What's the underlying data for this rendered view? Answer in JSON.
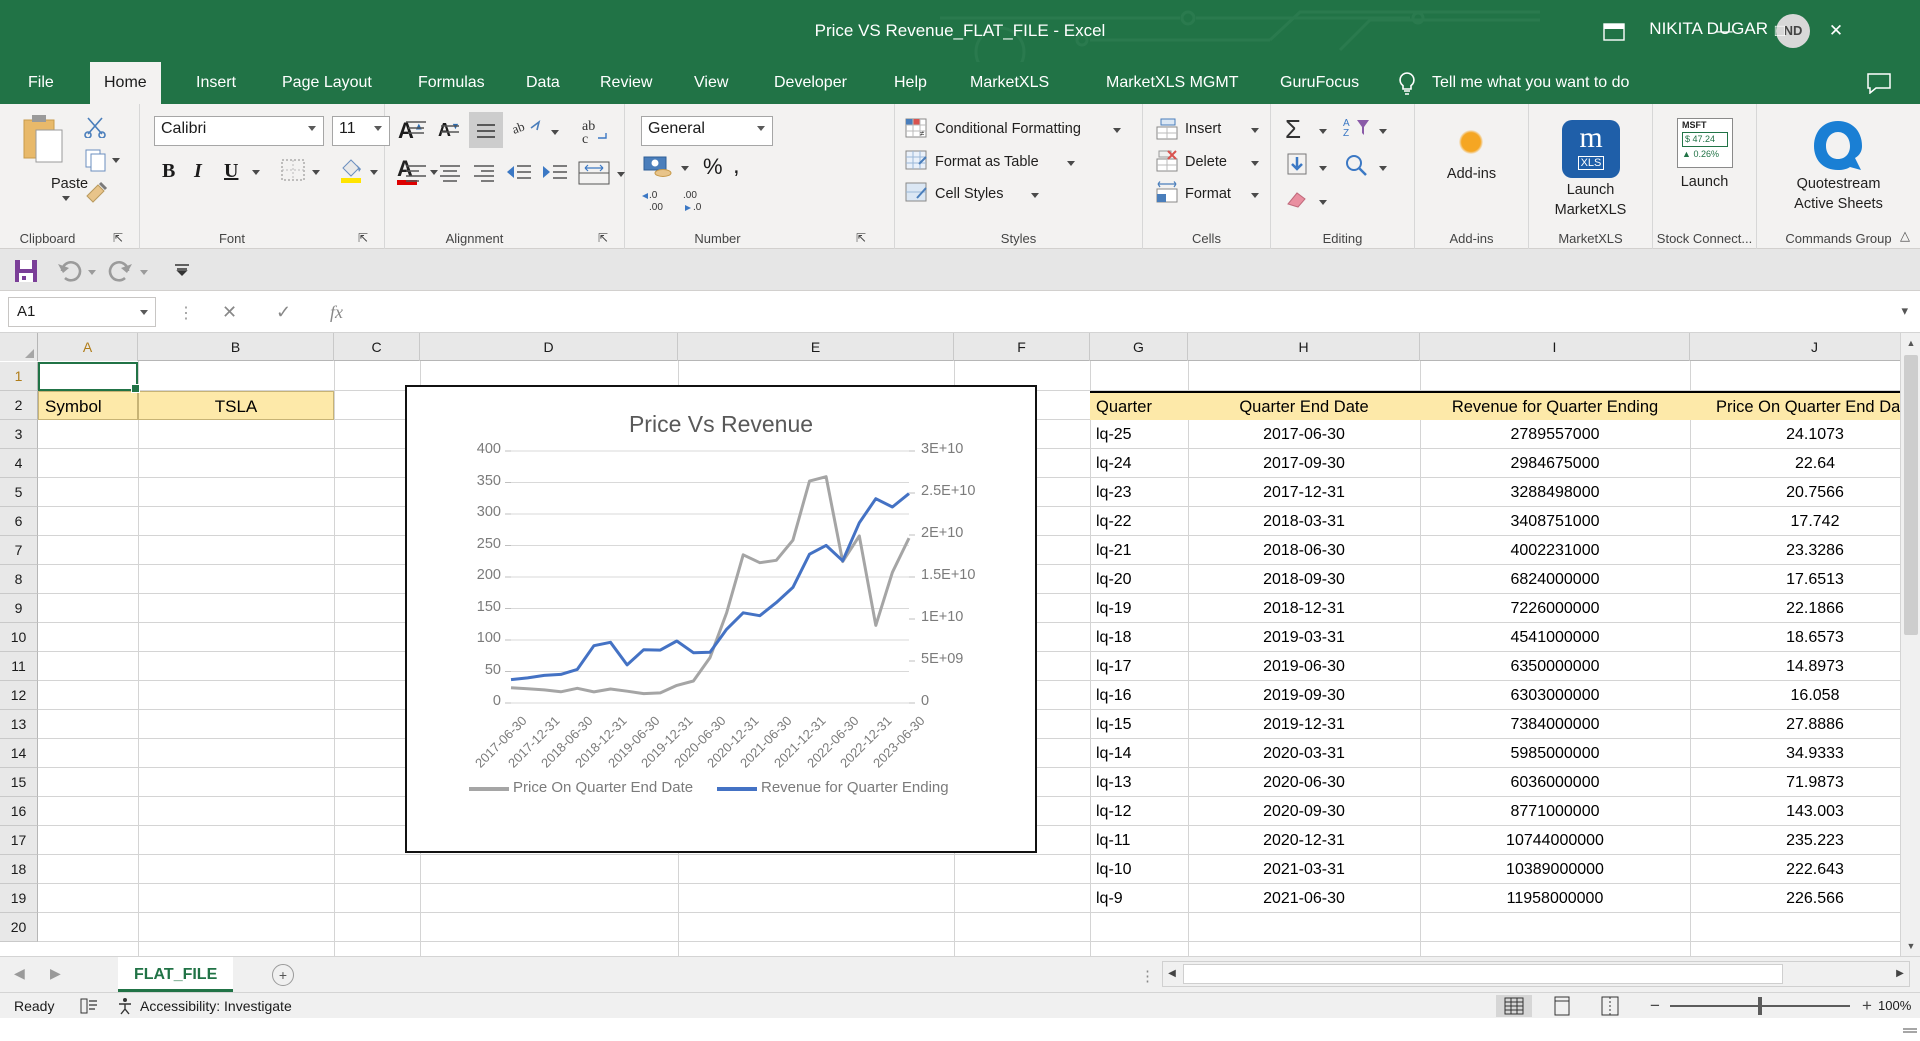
{
  "window": {
    "title": "Price VS Revenue_FLAT_FILE  -  Excel",
    "user": "NIKITA DUGAR",
    "avatar_initials": "ND",
    "ribbon_display_icon": "ribbon-display-options-icon",
    "minimize": "—",
    "maximize": "□",
    "close": "✕"
  },
  "tabs": [
    {
      "label": "File",
      "active": false
    },
    {
      "label": "Home",
      "active": true
    },
    {
      "label": "Insert",
      "active": false
    },
    {
      "label": "Page Layout",
      "active": false
    },
    {
      "label": "Formulas",
      "active": false
    },
    {
      "label": "Data",
      "active": false
    },
    {
      "label": "Review",
      "active": false
    },
    {
      "label": "View",
      "active": false
    },
    {
      "label": "Developer",
      "active": false
    },
    {
      "label": "Help",
      "active": false
    },
    {
      "label": "MarketXLS",
      "active": false
    },
    {
      "label": "MarketXLS MGMT",
      "active": false
    },
    {
      "label": "GuruFocus",
      "active": false
    }
  ],
  "tellme": "Tell me what you want to do",
  "ribbon": {
    "groups": [
      {
        "name": "Clipboard",
        "label": "Clipboard"
      },
      {
        "name": "Font",
        "label": "Font"
      },
      {
        "name": "Alignment",
        "label": "Alignment"
      },
      {
        "name": "Number",
        "label": "Number"
      },
      {
        "name": "Styles",
        "label": "Styles"
      },
      {
        "name": "Cells",
        "label": "Cells"
      },
      {
        "name": "Editing",
        "label": "Editing"
      },
      {
        "name": "Add-ins",
        "label": "Add-ins"
      },
      {
        "name": "MarketXLS",
        "label": "MarketXLS"
      },
      {
        "name": "StockConnect",
        "label": "Stock Connect..."
      },
      {
        "name": "CommandsGroup",
        "label": "Commands Group"
      }
    ],
    "clipboard": {
      "paste": "Paste",
      "cut_icon": "scissors-icon",
      "copy_icon": "copy-icon",
      "format_painter_icon": "format-painter-icon"
    },
    "font": {
      "family": "Calibri",
      "size": "11",
      "bold": "B",
      "italic": "I",
      "underline": "U",
      "grow_icon": "increase-font-size-icon",
      "shrink_icon": "decrease-font-size-icon",
      "borders_icon": "borders-icon",
      "fill_color_icon": "fill-color-icon",
      "font_color_icon": "font-color-icon"
    },
    "alignment": {
      "top_align_icon": "align-top-icon",
      "middle_align_icon": "align-middle-icon",
      "bottom_align_icon": "align-bottom-icon",
      "orientation_icon": "text-orientation-icon",
      "align_left_icon": "align-left-icon",
      "align_center_icon": "align-center-icon",
      "align_right_icon": "align-right-icon",
      "decrease_indent_icon": "decrease-indent-icon",
      "increase_indent_icon": "increase-indent-icon",
      "wrap_text_icon": "wrap-text-icon",
      "merge_center_icon": "merge-and-center-icon"
    },
    "number": {
      "format": "General",
      "accounting_icon": "accounting-number-format-icon",
      "percent": "%",
      "comma": " ,",
      "increase_decimal_icon": "increase-decimal-icon",
      "decrease_decimal_icon": "decrease-decimal-icon"
    },
    "styles": {
      "conditional_formatting": "Conditional Formatting",
      "format_as_table": "Format as Table",
      "cell_styles": "Cell Styles"
    },
    "cells": {
      "insert": "Insert",
      "delete": "Delete",
      "format": "Format"
    },
    "editing": {
      "autosum_icon": "autosum-sigma-icon",
      "fill_icon": "fill-down-icon",
      "clear_icon": "clear-eraser-icon",
      "sort_filter_icon": "sort-and-filter-icon",
      "find_select_icon": "find-and-select-icon"
    },
    "addins": {
      "label": "Add-ins",
      "icon": "add-ins-icon"
    },
    "marketxls": {
      "line1": "Launch",
      "line2": "MarketXLS",
      "icon": "marketxls-logo-icon"
    },
    "stockconnect": {
      "line1": "Launch",
      "ticker": "MSFT",
      "price": "$  47.24",
      "change": "0.26%"
    },
    "quotestream": {
      "line1": "Quotestream",
      "line2": "Active Sheets",
      "icon": "quotestream-q-logo-icon"
    }
  },
  "qat": {
    "save_icon": "save-icon",
    "undo_icon": "undo-icon",
    "redo_icon": "redo-icon",
    "customize_icon": "customize-quick-access-toolbar-icon"
  },
  "formulabar": {
    "namebox_value": "A1",
    "cancel_icon": "cancel-icon",
    "enter_icon": "enter-icon",
    "function_icon": "insert-function-fx-icon",
    "formula_value": "",
    "formula_placeholder": "",
    "expand_icon": "expand-formula-bar-icon"
  },
  "grid": {
    "columns": [
      "A",
      "B",
      "C",
      "D",
      "E",
      "F",
      "G",
      "H",
      "I",
      "J"
    ],
    "rows": [
      "1",
      "2",
      "3",
      "4",
      "5",
      "6",
      "7",
      "8",
      "9",
      "10",
      "11",
      "12",
      "13",
      "14",
      "15",
      "16",
      "17",
      "18",
      "19",
      "20"
    ],
    "active_cell": "A1",
    "symbol_label": "Symbol",
    "symbol_value": "TSLA",
    "table_headers": [
      "Quarter",
      "Quarter End Date",
      "Revenue for Quarter Ending",
      "Price On Quarter End Date"
    ],
    "table_rows": [
      [
        "lq-25",
        "2017-06-30",
        "2789557000",
        "24.1073"
      ],
      [
        "lq-24",
        "2017-09-30",
        "2984675000",
        "22.64"
      ],
      [
        "lq-23",
        "2017-12-31",
        "3288498000",
        "20.7566"
      ],
      [
        "lq-22",
        "2018-03-31",
        "3408751000",
        "17.742"
      ],
      [
        "lq-21",
        "2018-06-30",
        "4002231000",
        "23.3286"
      ],
      [
        "lq-20",
        "2018-09-30",
        "6824000000",
        "17.6513"
      ],
      [
        "lq-19",
        "2018-12-31",
        "7226000000",
        "22.1866"
      ],
      [
        "lq-18",
        "2019-03-31",
        "4541000000",
        "18.6573"
      ],
      [
        "lq-17",
        "2019-06-30",
        "6350000000",
        "14.8973"
      ],
      [
        "lq-16",
        "2019-09-30",
        "6303000000",
        "16.058"
      ],
      [
        "lq-15",
        "2019-12-31",
        "7384000000",
        "27.8886"
      ],
      [
        "lq-14",
        "2020-03-31",
        "5985000000",
        "34.9333"
      ],
      [
        "lq-13",
        "2020-06-30",
        "6036000000",
        "71.9873"
      ],
      [
        "lq-12",
        "2020-09-30",
        "8771000000",
        "143.003"
      ],
      [
        "lq-11",
        "2020-12-31",
        "10744000000",
        "235.223"
      ],
      [
        "lq-10",
        "2021-03-31",
        "10389000000",
        "222.643"
      ],
      [
        "lq-9",
        "2021-06-30",
        "11958000000",
        "226.566"
      ]
    ]
  },
  "chart_data": {
    "type": "line",
    "title": "Price Vs Revenue",
    "xlabel": "",
    "ylabel": "",
    "grid": true,
    "legend_position": "bottom",
    "x": [
      "2017-06-30",
      "2017-09-30",
      "2017-12-31",
      "2018-03-31",
      "2018-06-30",
      "2018-09-30",
      "2018-12-31",
      "2019-03-31",
      "2019-06-30",
      "2019-09-30",
      "2019-12-31",
      "2020-03-31",
      "2020-06-30",
      "2020-09-30",
      "2020-12-31",
      "2021-03-31",
      "2021-06-30",
      "2021-09-30",
      "2021-12-31",
      "2022-03-31",
      "2022-06-30",
      "2022-09-30",
      "2022-12-31",
      "2023-03-31",
      "2023-06-30"
    ],
    "xtick_labels": [
      "2017-06-30",
      "2017-12-31",
      "2018-06-30",
      "2018-12-31",
      "2019-06-30",
      "2019-12-31",
      "2020-06-30",
      "2020-12-31",
      "2021-06-30",
      "2021-12-31",
      "2022-06-30",
      "2022-12-31",
      "2023-06-30"
    ],
    "y_left_ticks": [
      "0",
      "50",
      "100",
      "150",
      "200",
      "250",
      "300",
      "350",
      "400"
    ],
    "y_left_lim": [
      0,
      400
    ],
    "y_right_ticks": [
      "0",
      "5E+09",
      "1E+10",
      "1.5E+10",
      "2E+10",
      "2.5E+10",
      "3E+10"
    ],
    "y_right_lim": [
      0,
      30000000000
    ],
    "series": [
      {
        "name": "Price On Quarter End Date",
        "axis": "left",
        "color": "#a5a5a5",
        "values": [
          24.1073,
          22.64,
          20.7566,
          17.742,
          23.3286,
          17.6513,
          22.1866,
          18.6573,
          14.8973,
          16.058,
          27.8886,
          34.9333,
          71.9873,
          143.003,
          235.223,
          222.643,
          226.566,
          258.49,
          352.26,
          359.2,
          224.47,
          265.25,
          123.18,
          207.46,
          261.77
        ]
      },
      {
        "name": "Revenue for Quarter Ending",
        "axis": "right",
        "color": "#4472c4",
        "values": [
          2789557000,
          2984675000,
          3288498000,
          3408751000,
          4002231000,
          6824000000,
          7226000000,
          4541000000,
          6350000000,
          6303000000,
          7384000000,
          5985000000,
          6036000000,
          8771000000,
          10744000000,
          10389000000,
          11958000000,
          13757000000,
          17719000000,
          18756000000,
          16934000000,
          21454000000,
          24318000000,
          23329000000,
          24927000000
        ]
      }
    ]
  },
  "sheet": {
    "nav_prev": "◀",
    "nav_next": "▶",
    "name": "FLAT_FILE",
    "add_label": "+"
  },
  "status": {
    "mode": "Ready",
    "accessibility": "Accessibility: Investigate",
    "zoom": "100%",
    "view_normal_icon": "normal-view-icon",
    "view_pagelayout_icon": "page-layout-view-icon",
    "view_pagebreak_icon": "page-break-preview-icon",
    "zoom_out": "−",
    "zoom_in": "+"
  }
}
